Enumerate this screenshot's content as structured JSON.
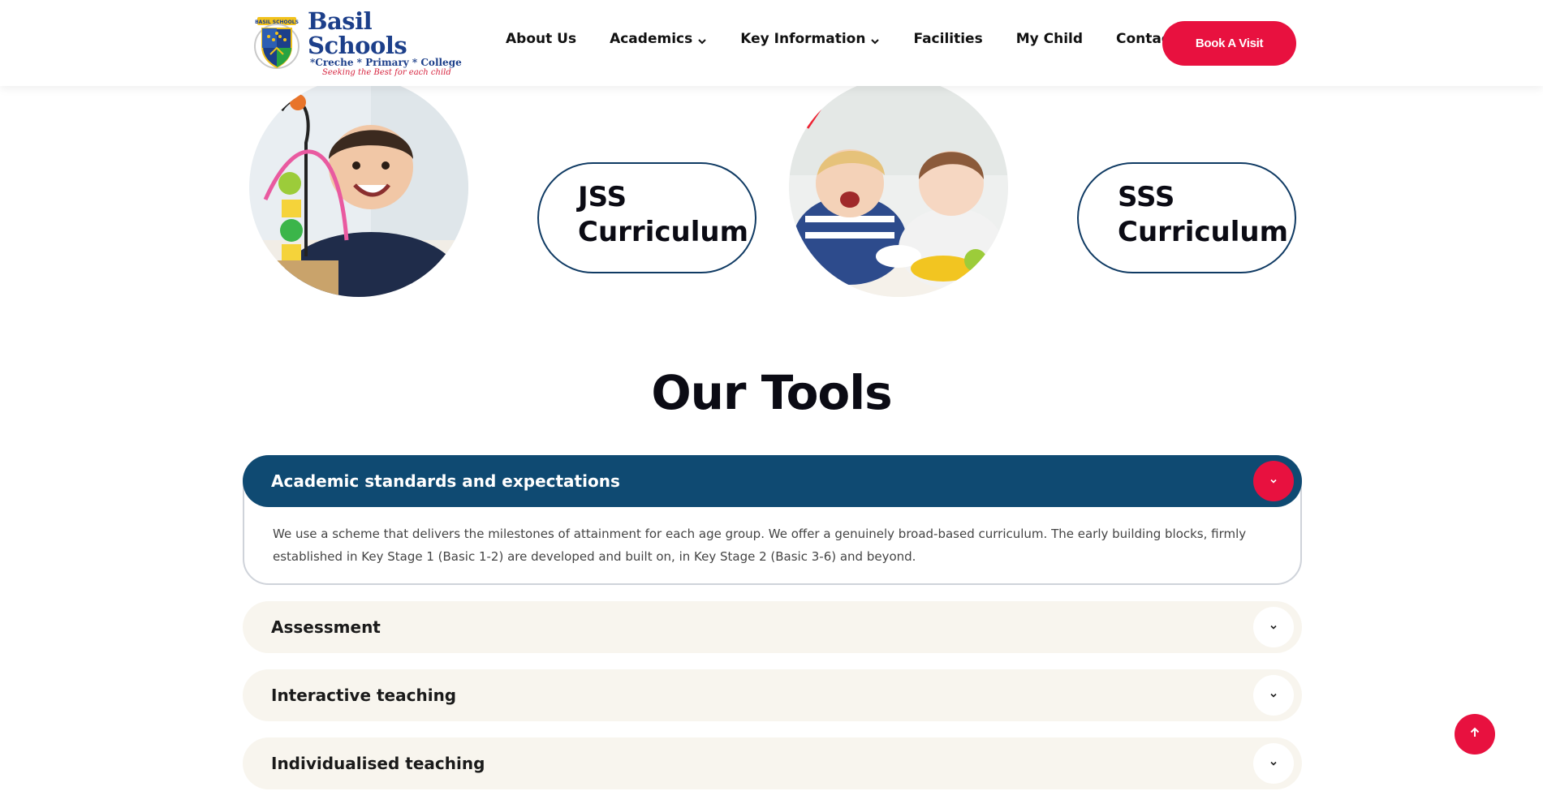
{
  "header": {
    "logo": {
      "title": "Basil Schools",
      "subtitle": "*Creche * Primary * College",
      "tagline": "Seeking the Best for each child",
      "crest_text": "BASIL SCHOOLS"
    },
    "nav": [
      {
        "label": "About Us",
        "has_dropdown": false
      },
      {
        "label": "Academics",
        "has_dropdown": true
      },
      {
        "label": "Key Information",
        "has_dropdown": true
      },
      {
        "label": "Facilities",
        "has_dropdown": false
      },
      {
        "label": "My Child",
        "has_dropdown": false
      },
      {
        "label": "Contact Us",
        "has_dropdown": false
      }
    ],
    "cta_label": "Book A Visit"
  },
  "curriculum": {
    "pill1": {
      "line1": "JSS",
      "line2": "Curriculum"
    },
    "pill2": {
      "line1": "SSS",
      "line2": "Curriculum"
    }
  },
  "tools": {
    "title": "Our Tools",
    "accordion": [
      {
        "label": "Academic standards and expectations",
        "expanded": true,
        "body": "We use a scheme that delivers the milestones of attainment for each age group. We offer a genuinely broad-based curriculum. The early building blocks, firmly established in Key Stage 1 (Basic 1-2) are developed and built on, in Key Stage 2 (Basic 3-6) and beyond."
      },
      {
        "label": "Assessment",
        "expanded": false
      },
      {
        "label": "Interactive teaching",
        "expanded": false
      },
      {
        "label": "Individualised teaching",
        "expanded": false
      }
    ]
  },
  "colors": {
    "accent_red": "#e8113f",
    "navy": "#0f4a72",
    "pill_border": "#0f3a63",
    "accordion_bg": "#f8f5ee"
  },
  "icons": {
    "dropdown": "chevron-down-icon",
    "scroll_top": "arrow-up-icon"
  }
}
